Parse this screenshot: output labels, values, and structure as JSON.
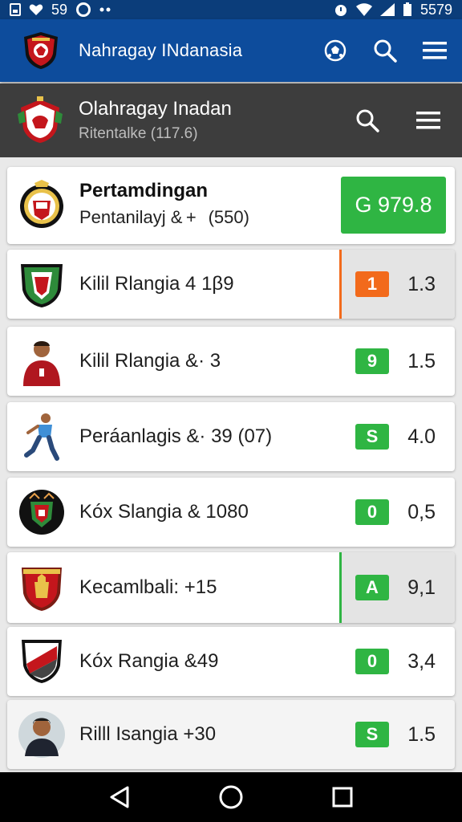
{
  "status_bar": {
    "left_text": "59",
    "right_text": "5579"
  },
  "app_bar": {
    "title": "Nahragay INdanasia"
  },
  "sub_header": {
    "title": "Olahragay Inadan",
    "subtitle": "Ritentalke (117.6)"
  },
  "summary_card": {
    "title": "Pertamdingan",
    "subtitle": "Pentanilayj & +   (550)",
    "total": "G 979.8"
  },
  "matches": [
    {
      "label": "Kilil Rlangia 4  1β9",
      "badge": "1",
      "badge_color": "#f26a1b",
      "odds": "1.3"
    },
    {
      "label": "Kilil Rlangia &· 3",
      "badge": "9",
      "badge_color": "#2fb543",
      "odds": "1.5"
    },
    {
      "label": "Peráanlagis &· 39  (07)",
      "badge": "S",
      "badge_color": "#2fb543",
      "odds": "4.0"
    },
    {
      "label": "Kóx Slangia & 1080",
      "badge": "0",
      "badge_color": "#2fb543",
      "odds": "0,5"
    },
    {
      "label": "Kecamlbali: +15",
      "badge": "A",
      "badge_color": "#2fb543",
      "odds": "9,1"
    },
    {
      "label": "Kóx Rangia &49",
      "badge": "0",
      "badge_color": "#2fb543",
      "odds": "3,4"
    },
    {
      "label": "Rilll Isangia +30",
      "badge": "S",
      "badge_color": "#2fb543",
      "odds": "1.5"
    }
  ],
  "colors": {
    "primary": "#0d4c9c",
    "status": "#0b3d7a",
    "sub_header": "#3d3d3d",
    "green": "#2fb543",
    "orange": "#f26a1b"
  },
  "icons": {
    "app_bar": [
      "club-crest-icon",
      "soccer-ball-icon",
      "search-icon",
      "menu-icon"
    ],
    "sub_header": [
      "club-crest-icon",
      "search-icon",
      "menu-icon"
    ],
    "nav": [
      "back-icon",
      "home-icon",
      "recents-icon"
    ]
  }
}
